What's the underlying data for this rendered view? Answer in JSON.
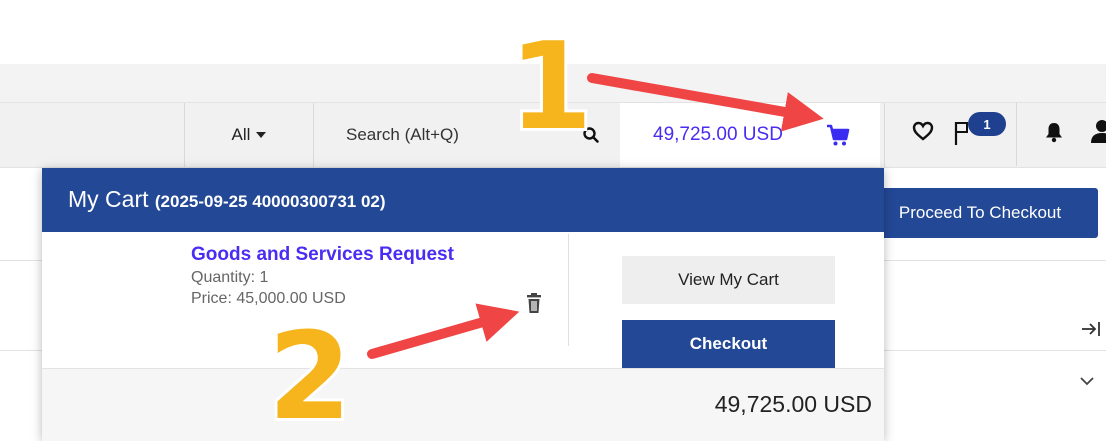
{
  "navbar": {
    "filter_label": "All",
    "search_placeholder": "Search (Alt+Q)",
    "cart_total": "49,725.00 USD",
    "notification_badge": "1",
    "icons": [
      "cart-icon",
      "heart-icon",
      "flag-icon",
      "bell-icon",
      "user-icon",
      "search-icon"
    ]
  },
  "page": {
    "proceed_button": "Proceed To Checkout"
  },
  "cart": {
    "title": "My Cart",
    "reference": "(2025-09-25 40000300731 02)",
    "item": {
      "name": "Goods and Services Request",
      "quantity": "Quantity: 1",
      "price": "Price: 45,000.00 USD"
    },
    "view_cart_button": "View My Cart",
    "checkout_button": "Checkout",
    "total": "49,725.00 USD"
  },
  "annotations": {
    "step1": "1",
    "step2": "2",
    "arrow_color": "#f04545",
    "number_color": "#f6b41d"
  },
  "colors": {
    "brand_blue": "#234896",
    "link_purple": "#4a2cf2"
  }
}
